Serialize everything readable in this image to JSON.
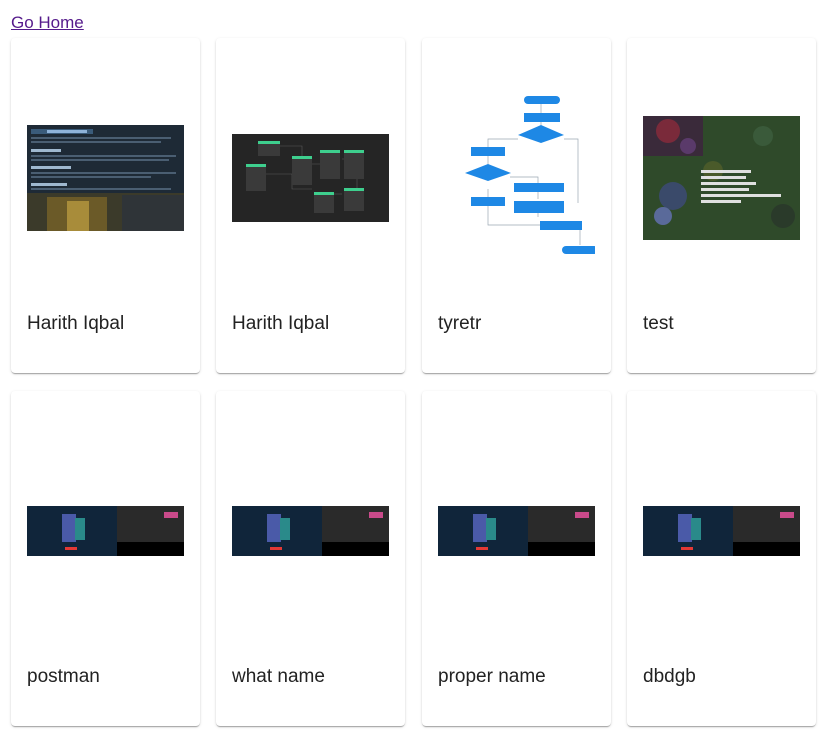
{
  "nav": {
    "home_label": "Go Home"
  },
  "cards": [
    {
      "title": "Harith Iqbal",
      "image": "document-screenshot"
    },
    {
      "title": "Harith Iqbal",
      "image": "database-schema-diagram"
    },
    {
      "title": "tyretr",
      "image": "flowchart-diagram"
    },
    {
      "title": "test",
      "image": "game-screenshot"
    },
    {
      "title": "postman",
      "image": "game-lobby-screenshot"
    },
    {
      "title": "what name",
      "image": "game-lobby-screenshot"
    },
    {
      "title": "proper name",
      "image": "game-lobby-screenshot"
    },
    {
      "title": "dbdgb",
      "image": "game-lobby-screenshot"
    }
  ]
}
